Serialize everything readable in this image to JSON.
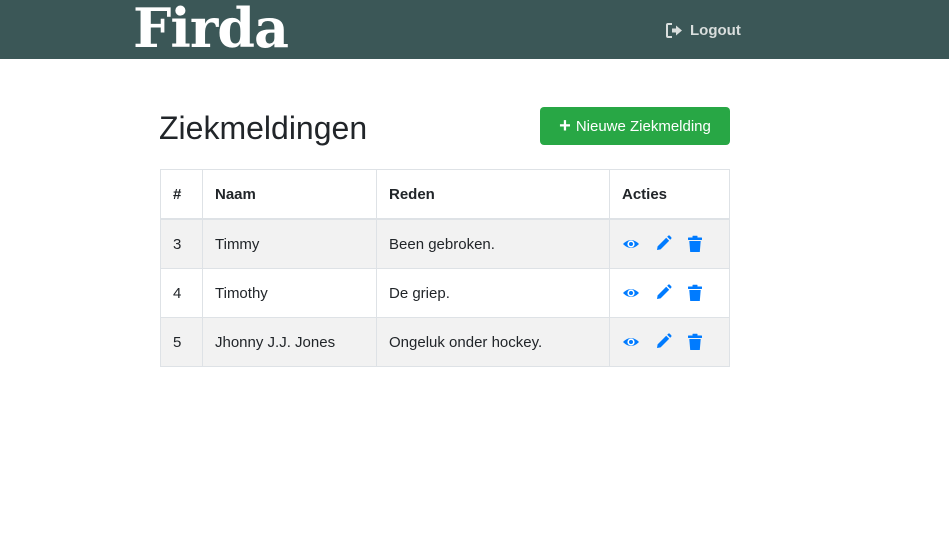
{
  "navbar": {
    "logo_text": "Firda",
    "logout_label": "Logout"
  },
  "page": {
    "title": "Ziekmeldingen",
    "new_button_label": "Nieuwe Ziekmelding"
  },
  "table": {
    "headers": [
      "#",
      "Naam",
      "Reden",
      "Acties"
    ],
    "rows": [
      {
        "id": "3",
        "naam": "Timmy",
        "reden": "Been gebroken."
      },
      {
        "id": "4",
        "naam": "Timothy",
        "reden": "De griep."
      },
      {
        "id": "5",
        "naam": "Jhonny J.J. Jones",
        "reden": "Ongeluk onder hockey."
      }
    ],
    "action_icons": [
      "eye-icon",
      "pencil-icon",
      "trash-icon"
    ]
  },
  "colors": {
    "navbar": "#3b5757",
    "success": "#28a745",
    "link": "#007bff",
    "stripe": "#f2f2f2"
  }
}
